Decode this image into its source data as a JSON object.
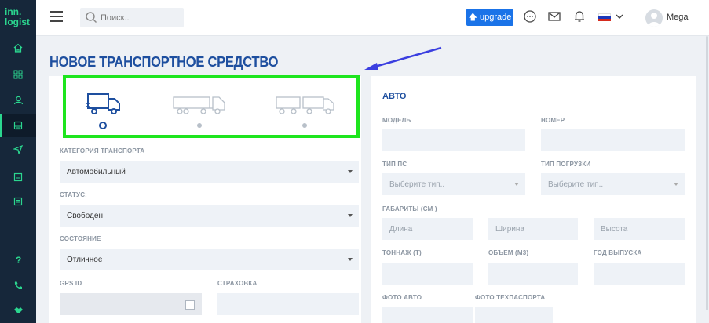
{
  "logo": {
    "line1": "inn.",
    "line2": "logist"
  },
  "search": {
    "placeholder": "Поиск.."
  },
  "header": {
    "upgrade_label": "upgrade",
    "username": "Mega"
  },
  "colors": {
    "accent": "#1e4f9f",
    "highlight": "#1ee51e",
    "sidebar": "#16273a",
    "logo": "#2bd68f",
    "upgrade": "#1a73e8",
    "arrow": "#3b3fe0"
  },
  "sidebar": {
    "items": [
      {
        "icon": "home-icon"
      },
      {
        "icon": "dashboard-icon"
      },
      {
        "icon": "users-icon"
      },
      {
        "icon": "truck-icon",
        "active": true
      },
      {
        "icon": "send-icon"
      },
      {
        "icon": "document-icon"
      },
      {
        "icon": "document-icon"
      },
      {
        "icon": "help-icon"
      },
      {
        "icon": "phone-icon"
      },
      {
        "icon": "handshake-icon"
      }
    ]
  },
  "page": {
    "title": "НОВОЕ ТРАНСПОРТНОЕ СРЕДСТВО"
  },
  "vehicle_types": [
    {
      "icon": "small-truck-icon",
      "selected": true
    },
    {
      "icon": "truck-trailer-icon",
      "selected": false
    },
    {
      "icon": "road-train-icon",
      "selected": false
    }
  ],
  "left_form": {
    "category": {
      "label": "КАТЕГОРИЯ ТРАНСПОРТА",
      "value": "Автомобильный"
    },
    "status": {
      "label": "СТАТУС:",
      "value": "Свободен"
    },
    "condition": {
      "label": "СОСТОЯНИЕ",
      "value": "Отличное"
    },
    "gps": {
      "label": "GPS ID"
    },
    "insurance": {
      "label": "СТРАХОВКА"
    }
  },
  "right_form": {
    "section_title": "АВТО",
    "model": {
      "label": "МОДЕЛЬ"
    },
    "number": {
      "label": "НОМЕР"
    },
    "ps_type": {
      "label": "ТИП ПС",
      "placeholder": "Выберите тип.."
    },
    "load_type": {
      "label": "ТИП ПОГРУЗКИ",
      "placeholder": "Выберите тип.."
    },
    "dimensions": {
      "label": "ГАБАРИТЫ (СМ )",
      "length": "Длина",
      "width": "Ширина",
      "height": "Высота"
    },
    "tonnage": {
      "label": "ТОННАЖ (Т)"
    },
    "volume": {
      "label": "ОБЪЕМ (М3)"
    },
    "year": {
      "label": "ГОД ВЫПУСКА"
    },
    "photo_auto": {
      "label": "ФОТО АВТО"
    },
    "photo_passport": {
      "label": "ФОТО ТЕХПАСПОРТА"
    }
  }
}
